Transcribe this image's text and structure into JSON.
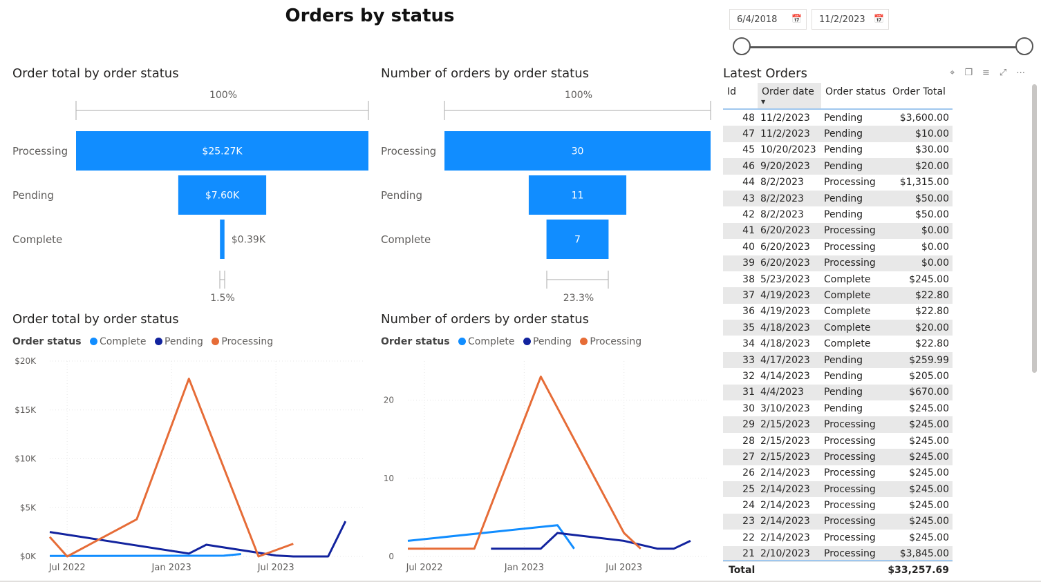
{
  "page_title": "Orders by status",
  "date_filter": {
    "start": "6/4/2018",
    "end": "11/2/2023"
  },
  "funnel_total": {
    "title": "Order total by order status",
    "top_pct": "100%",
    "bottom_pct": "1.5%"
  },
  "funnel_count": {
    "title": "Number of orders by order status",
    "top_pct": "100%",
    "bottom_pct": "23.3%"
  },
  "line_total": {
    "title": "Order total by order status"
  },
  "line_count": {
    "title": "Number of orders by order status"
  },
  "legend": {
    "title": "Order status",
    "items": [
      {
        "label": "Complete",
        "color": "#118dff"
      },
      {
        "label": "Pending",
        "color": "#12239e"
      },
      {
        "label": "Processing",
        "color": "#e66c37"
      }
    ]
  },
  "chart_data": [
    {
      "type": "bar",
      "subtype": "funnel",
      "title": "Order total by order status",
      "categories": [
        "Processing",
        "Pending",
        "Complete"
      ],
      "values": [
        25270,
        7600,
        390
      ],
      "data_labels": [
        "$25.27K",
        "$7.60K",
        "$0.39K"
      ],
      "color": "#118dff"
    },
    {
      "type": "bar",
      "subtype": "funnel",
      "title": "Number of orders by order status",
      "categories": [
        "Processing",
        "Pending",
        "Complete"
      ],
      "values": [
        30,
        11,
        7
      ],
      "data_labels": [
        "30",
        "11",
        "7"
      ],
      "color": "#118dff"
    },
    {
      "type": "line",
      "title": "Order total by order status",
      "x_ticks": [
        "Jul 2022",
        "Jan 2023",
        "Jul 2023"
      ],
      "y_ticks": [
        "$0K",
        "$5K",
        "$10K",
        "$15K",
        "$20K"
      ],
      "ylim": [
        0,
        20000
      ],
      "xlim": [
        "2022-06",
        "2023-12"
      ],
      "grid": true,
      "series": [
        {
          "name": "Complete",
          "color": "#118dff",
          "x": [
            "2022-06",
            "2023-04",
            "2023-05"
          ],
          "y": [
            50,
            80,
            250
          ]
        },
        {
          "name": "Pending",
          "color": "#12239e",
          "x": [
            "2022-06",
            "2023-02",
            "2023-03",
            "2023-07",
            "2023-08",
            "2023-10",
            "2023-11"
          ],
          "y": [
            2500,
            300,
            1200,
            100,
            0,
            0,
            3600
          ]
        },
        {
          "name": "Processing",
          "color": "#e66c37",
          "x": [
            "2022-06",
            "2022-07",
            "2022-11",
            "2023-02",
            "2023-06",
            "2023-08"
          ],
          "y": [
            2000,
            0,
            3800,
            18200,
            0,
            1300
          ]
        }
      ]
    },
    {
      "type": "line",
      "title": "Number of orders by order status",
      "x_ticks": [
        "Jul 2022",
        "Jan 2023",
        "Jul 2023"
      ],
      "y_ticks": [
        "0",
        "10",
        "20"
      ],
      "ylim": [
        0,
        25
      ],
      "xlim": [
        "2022-06",
        "2023-12"
      ],
      "grid": true,
      "series": [
        {
          "name": "Complete",
          "color": "#118dff",
          "x": [
            "2022-06",
            "2023-03",
            "2023-04"
          ],
          "y": [
            2,
            4,
            1
          ]
        },
        {
          "name": "Pending",
          "color": "#12239e",
          "x": [
            "2022-11",
            "2023-02",
            "2023-03",
            "2023-07",
            "2023-09",
            "2023-10",
            "2023-11"
          ],
          "y": [
            1,
            1,
            3,
            2,
            1,
            1,
            2
          ]
        },
        {
          "name": "Processing",
          "color": "#e66c37",
          "x": [
            "2022-06",
            "2022-10",
            "2023-02",
            "2023-07",
            "2023-08"
          ],
          "y": [
            1,
            1,
            23,
            3,
            1
          ]
        }
      ]
    }
  ],
  "latest_orders": {
    "title": "Latest Orders",
    "columns": [
      "Id",
      "Order date",
      "Order status",
      "Order Total"
    ],
    "rows": [
      [
        "48",
        "11/2/2023",
        "Pending",
        "$3,600.00"
      ],
      [
        "47",
        "11/2/2023",
        "Pending",
        "$10.00"
      ],
      [
        "45",
        "10/20/2023",
        "Pending",
        "$30.00"
      ],
      [
        "46",
        "9/20/2023",
        "Pending",
        "$20.00"
      ],
      [
        "44",
        "8/2/2023",
        "Processing",
        "$1,315.00"
      ],
      [
        "43",
        "8/2/2023",
        "Pending",
        "$50.00"
      ],
      [
        "42",
        "8/2/2023",
        "Pending",
        "$50.00"
      ],
      [
        "41",
        "6/20/2023",
        "Processing",
        "$0.00"
      ],
      [
        "40",
        "6/20/2023",
        "Processing",
        "$0.00"
      ],
      [
        "39",
        "6/20/2023",
        "Processing",
        "$0.00"
      ],
      [
        "38",
        "5/23/2023",
        "Complete",
        "$245.00"
      ],
      [
        "37",
        "4/19/2023",
        "Complete",
        "$22.80"
      ],
      [
        "36",
        "4/19/2023",
        "Complete",
        "$22.80"
      ],
      [
        "35",
        "4/18/2023",
        "Complete",
        "$20.00"
      ],
      [
        "34",
        "4/18/2023",
        "Complete",
        "$22.80"
      ],
      [
        "33",
        "4/17/2023",
        "Pending",
        "$259.99"
      ],
      [
        "32",
        "4/14/2023",
        "Pending",
        "$205.00"
      ],
      [
        "31",
        "4/4/2023",
        "Pending",
        "$670.00"
      ],
      [
        "30",
        "3/10/2023",
        "Pending",
        "$245.00"
      ],
      [
        "29",
        "2/15/2023",
        "Processing",
        "$245.00"
      ],
      [
        "28",
        "2/15/2023",
        "Processing",
        "$245.00"
      ],
      [
        "27",
        "2/15/2023",
        "Processing",
        "$245.00"
      ],
      [
        "26",
        "2/14/2023",
        "Processing",
        "$245.00"
      ],
      [
        "25",
        "2/14/2023",
        "Processing",
        "$245.00"
      ],
      [
        "24",
        "2/14/2023",
        "Processing",
        "$245.00"
      ],
      [
        "23",
        "2/14/2023",
        "Processing",
        "$245.00"
      ],
      [
        "22",
        "2/14/2023",
        "Processing",
        "$245.00"
      ],
      [
        "21",
        "2/10/2023",
        "Processing",
        "$3,845.00"
      ]
    ],
    "total_label": "Total",
    "total_value": "$33,257.69"
  }
}
